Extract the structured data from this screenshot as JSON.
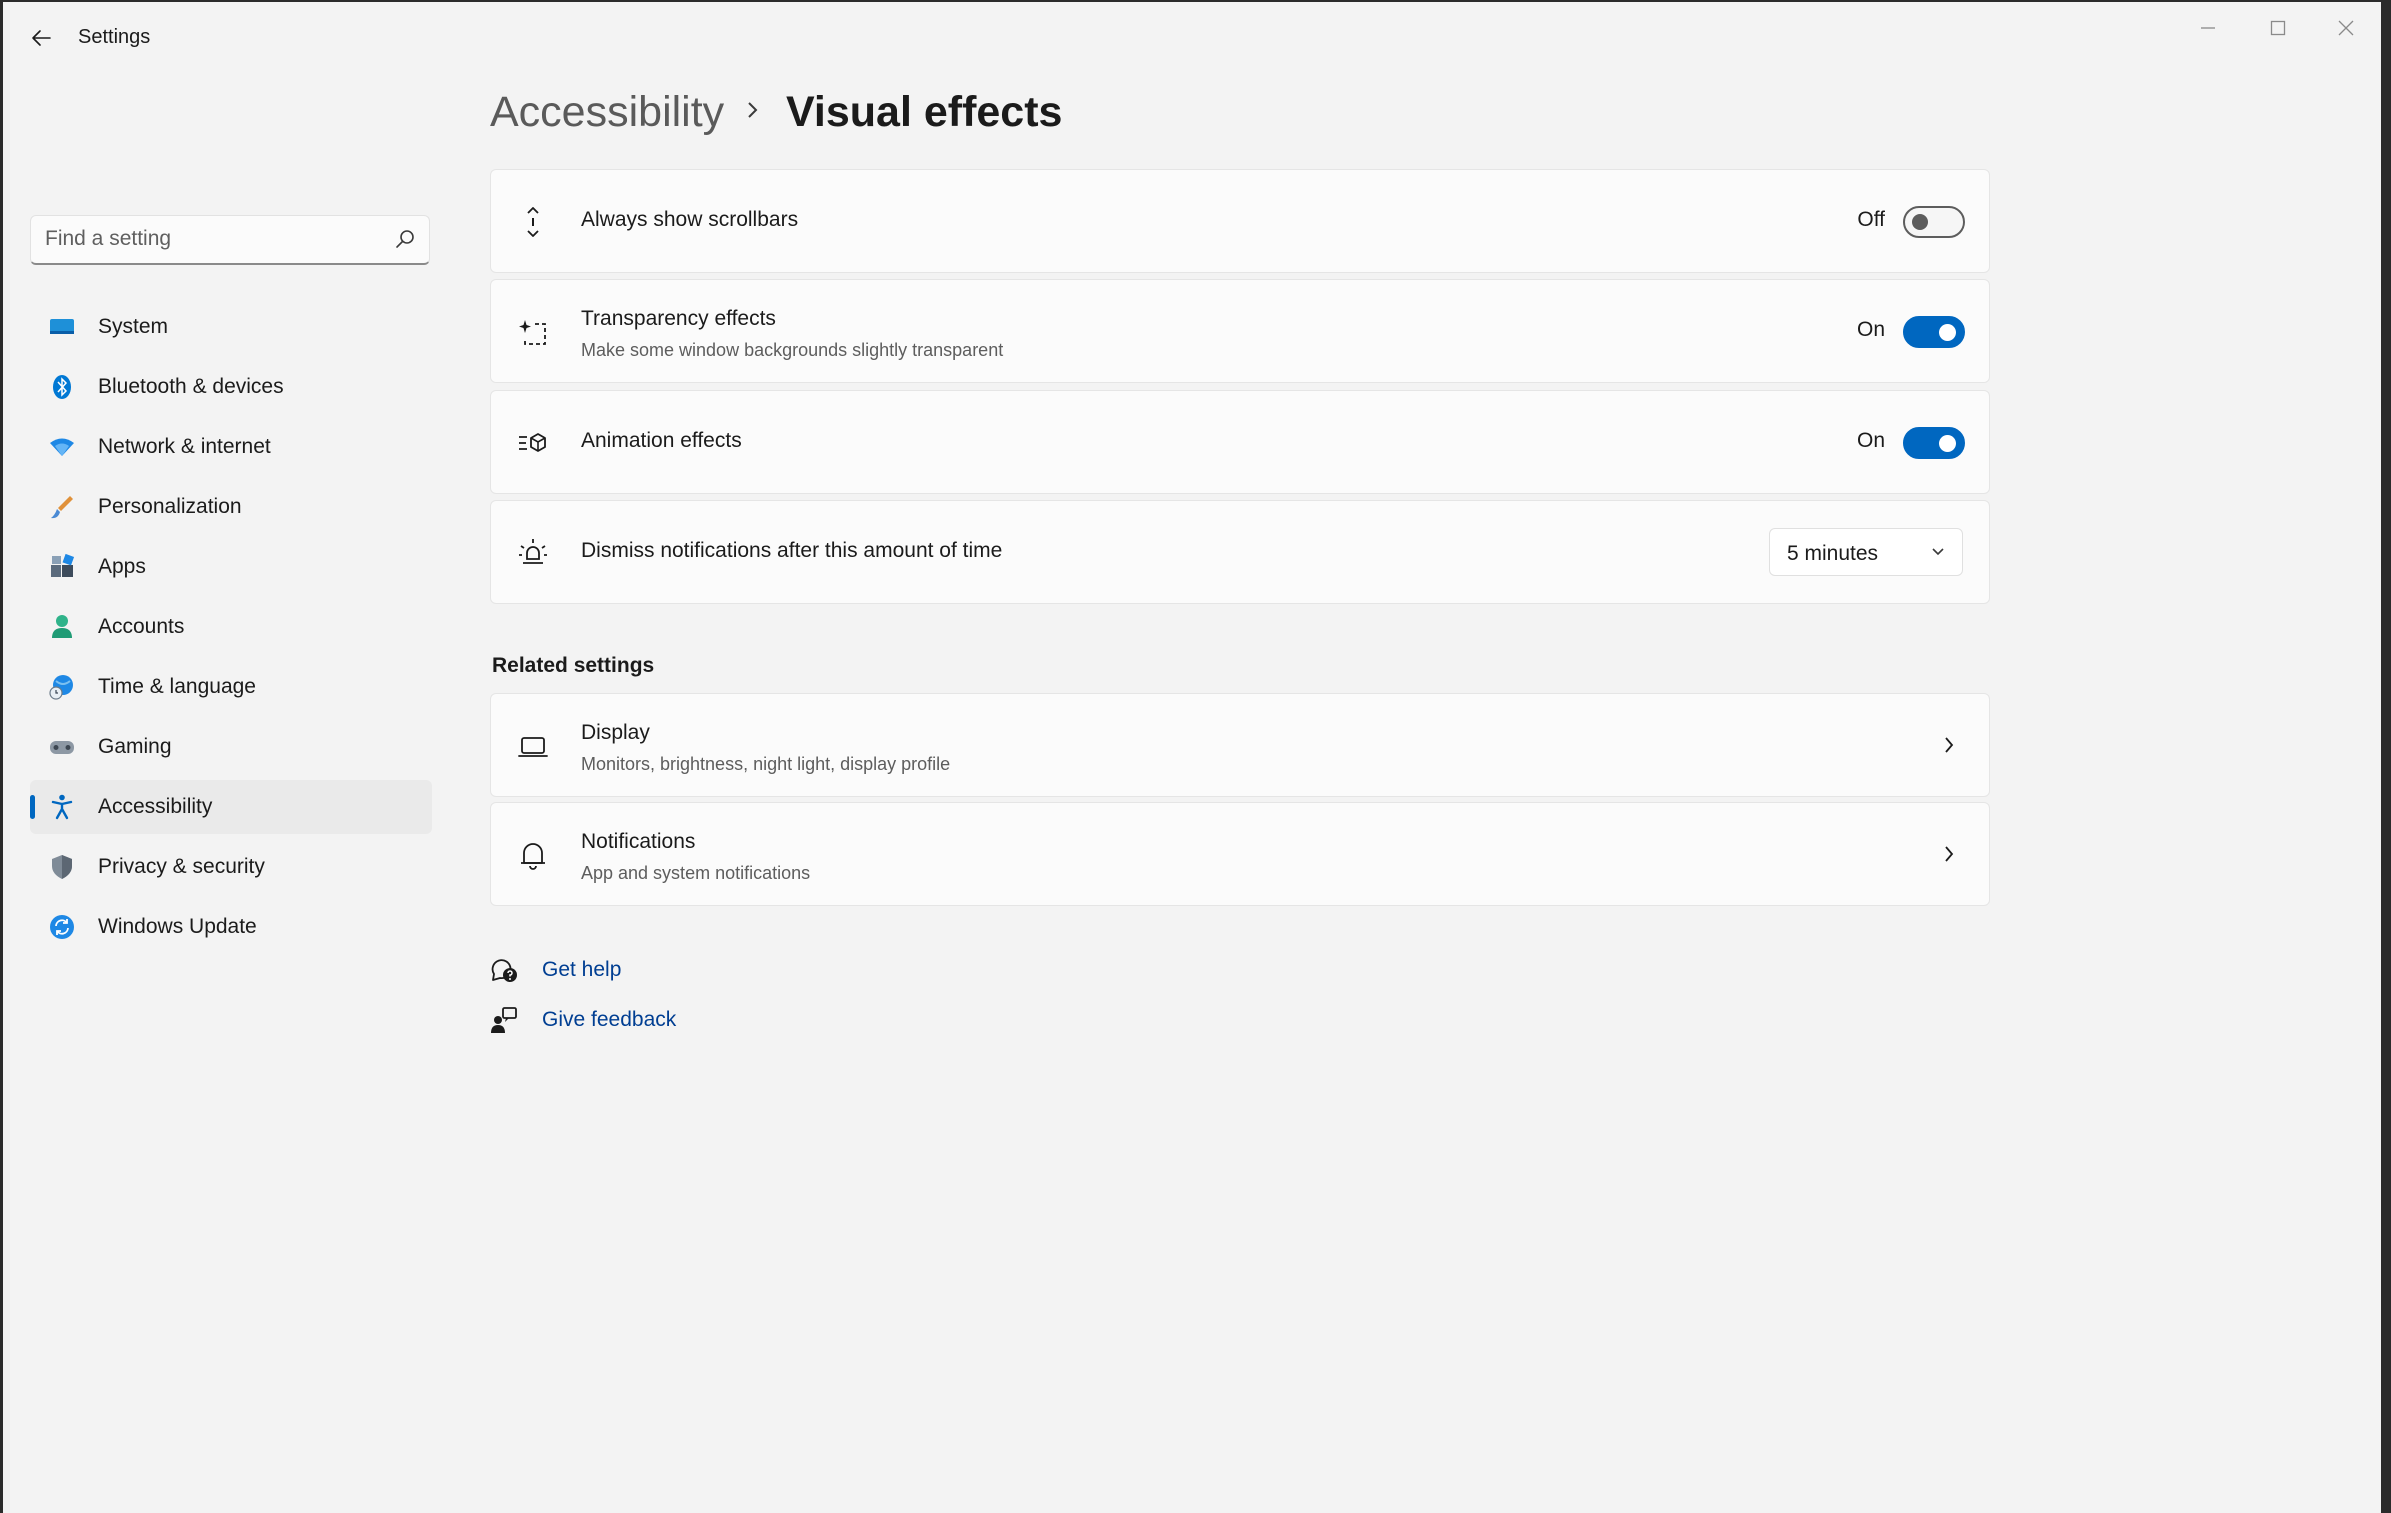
{
  "window": {
    "title": "Settings"
  },
  "search": {
    "placeholder": "Find a setting"
  },
  "sidebar": {
    "items": [
      {
        "label": "System",
        "icon": "system-icon"
      },
      {
        "label": "Bluetooth & devices",
        "icon": "bluetooth-icon"
      },
      {
        "label": "Network & internet",
        "icon": "wifi-icon"
      },
      {
        "label": "Personalization",
        "icon": "brush-icon"
      },
      {
        "label": "Apps",
        "icon": "apps-icon"
      },
      {
        "label": "Accounts",
        "icon": "person-icon"
      },
      {
        "label": "Time & language",
        "icon": "globe-clock-icon"
      },
      {
        "label": "Gaming",
        "icon": "controller-icon"
      },
      {
        "label": "Accessibility",
        "icon": "accessibility-icon",
        "active": true
      },
      {
        "label": "Privacy & security",
        "icon": "shield-icon"
      },
      {
        "label": "Windows Update",
        "icon": "update-icon"
      }
    ]
  },
  "breadcrumb": {
    "parent": "Accessibility",
    "current": "Visual effects"
  },
  "settings": {
    "scrollbars": {
      "title": "Always show scrollbars",
      "state_label": "Off",
      "on": false
    },
    "transparency": {
      "title": "Transparency effects",
      "subtitle": "Make some window backgrounds slightly transparent",
      "state_label": "On",
      "on": true
    },
    "animation": {
      "title": "Animation effects",
      "state_label": "On",
      "on": true
    },
    "notifications_timeout": {
      "title": "Dismiss notifications after this amount of time",
      "value": "5 minutes"
    }
  },
  "related": {
    "title": "Related settings",
    "display": {
      "title": "Display",
      "subtitle": "Monitors, brightness, night light, display profile"
    },
    "notifications": {
      "title": "Notifications",
      "subtitle": "App and system notifications"
    }
  },
  "help": {
    "get_help": "Get help",
    "give_feedback": "Give feedback"
  },
  "colors": {
    "accent": "#0067c0",
    "link": "#003e92",
    "background": "#f3f3f3",
    "card": "#fbfbfb"
  }
}
